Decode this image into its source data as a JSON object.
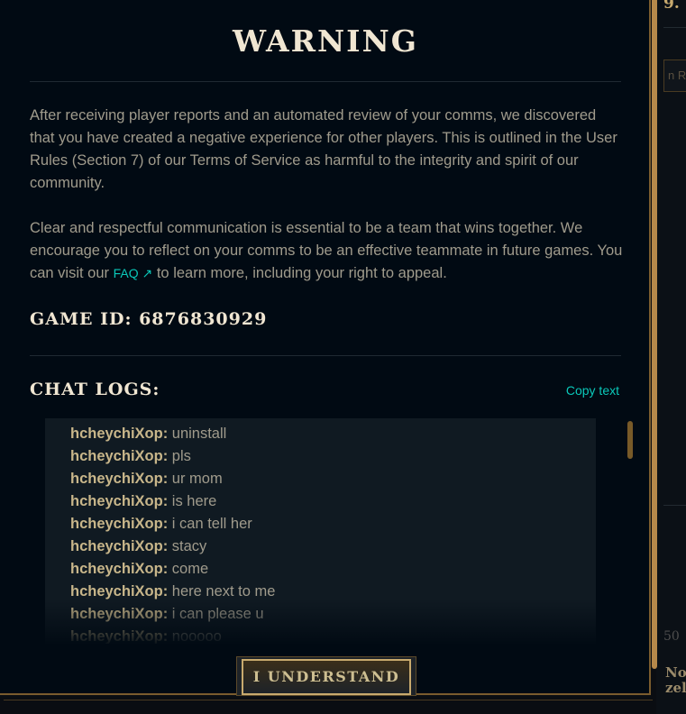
{
  "modal": {
    "title": "WARNING",
    "paragraph1": "After receiving player reports and an automated review of your comms, we discovered that you have created a negative experience for other players. This is outlined in the User Rules (Section 7) of our Terms of Service as harmful to the integrity and spirit of our community.",
    "paragraph2_before_link": "Clear and respectful communication is essential to be a team that wins together. We encourage you to reflect on your comms to be an effective teammate in future games. You can visit our ",
    "faq_label": "FAQ",
    "faq_arrow": "↗",
    "paragraph2_after_link": " to learn more, including your right to appeal.",
    "game_id": "GAME ID: 6876830929",
    "chat_logs_heading": "CHAT LOGS:",
    "copy_text": "Copy text",
    "chat_lines": [
      {
        "name": "hcheychiXop:",
        "message": "uninstall"
      },
      {
        "name": "hcheychiXop:",
        "message": "pls"
      },
      {
        "name": "hcheychiXop:",
        "message": "ur mom"
      },
      {
        "name": "hcheychiXop:",
        "message": "is here"
      },
      {
        "name": "hcheychiXop:",
        "message": "i can tell her"
      },
      {
        "name": "hcheychiXop:",
        "message": "stacy"
      },
      {
        "name": "hcheychiXop:",
        "message": "come"
      },
      {
        "name": "hcheychiXop:",
        "message": "here next to me"
      },
      {
        "name": "hcheychiXop:",
        "message": "i can please u"
      },
      {
        "name": "hcheychiXop:",
        "message": "nooooo"
      }
    ],
    "button_label": "I UNDERSTAND"
  },
  "background": {
    "top_text": "9.",
    "field_text": "n R",
    "bottom_text": "50",
    "bottom_name_1": "No",
    "bottom_name_2": "zelyn"
  },
  "colors": {
    "gold": "#c8aa6e",
    "cream": "#f0e6d2",
    "body_text": "#a09b8c",
    "link_teal": "#0ac8b9",
    "modal_bg": "#010a13"
  }
}
